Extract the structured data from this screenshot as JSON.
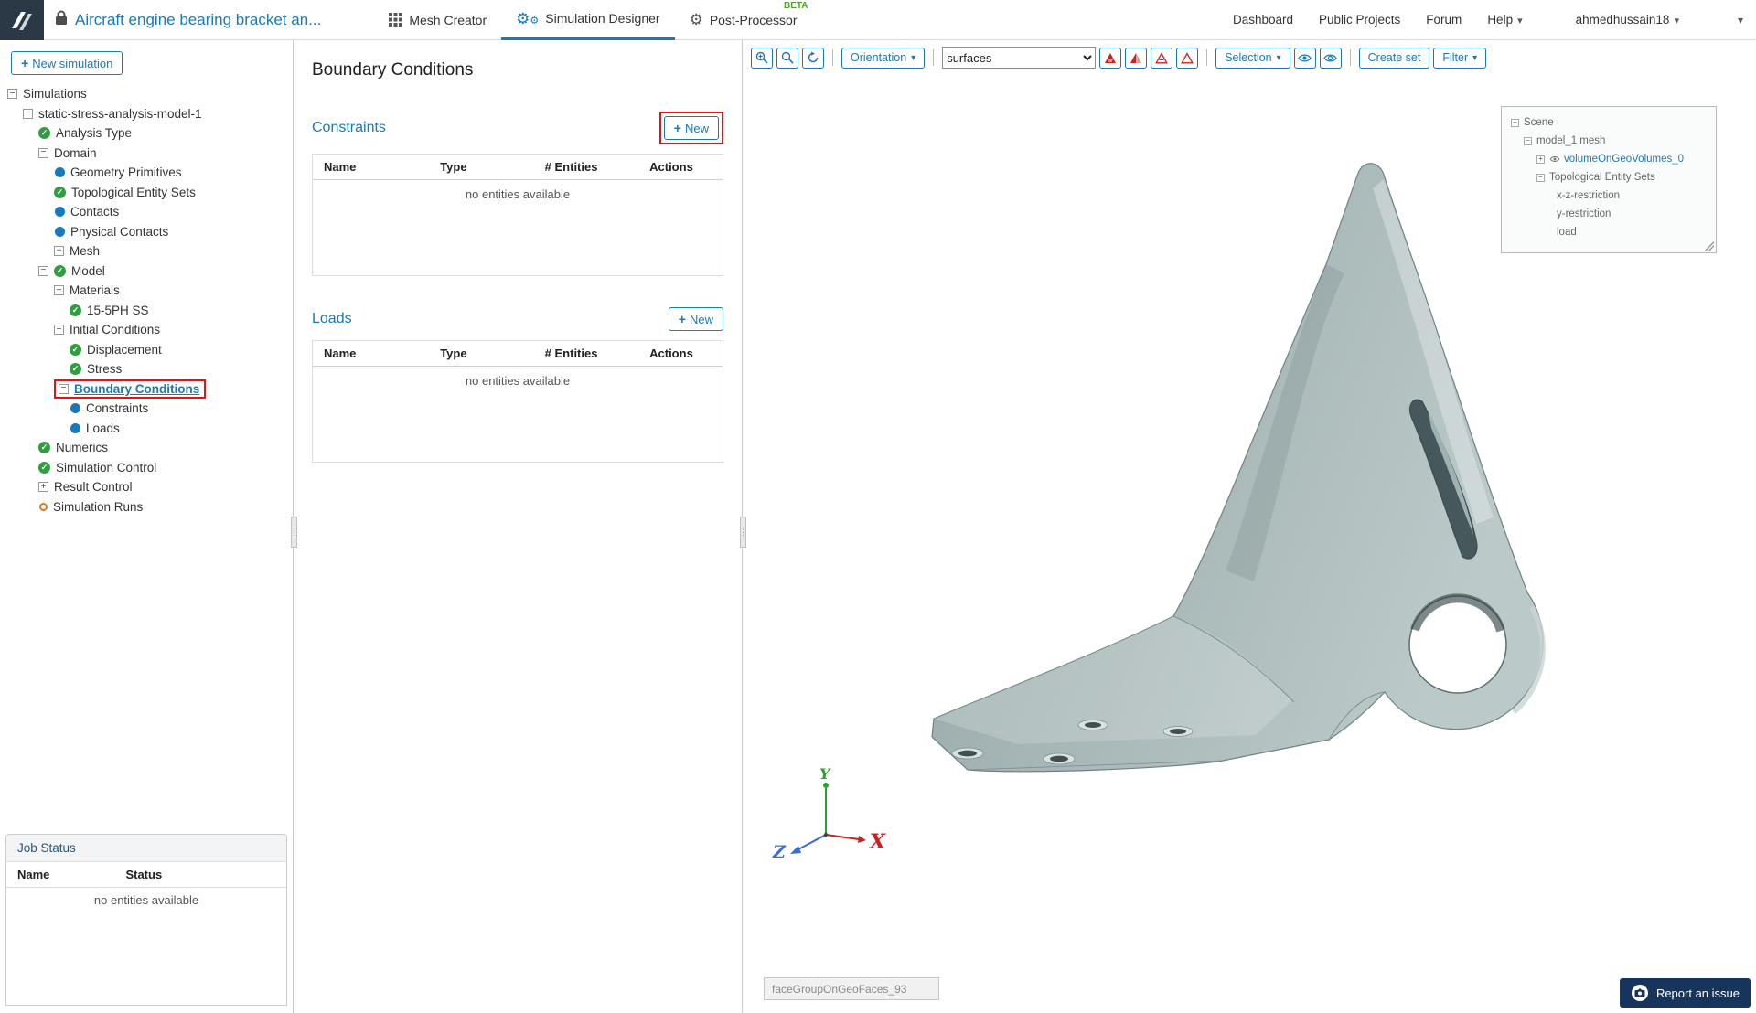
{
  "navbar": {
    "project_title": "Aircraft engine bearing bracket an...",
    "tabs": [
      {
        "label": "Mesh Creator"
      },
      {
        "label": "Simulation Designer"
      },
      {
        "label": "Post-Processor",
        "beta": "BETA"
      }
    ],
    "links": {
      "dashboard": "Dashboard",
      "public_projects": "Public Projects",
      "forum": "Forum",
      "help": "Help"
    },
    "user": "ahmedhussain18"
  },
  "sidebar": {
    "new_simulation_label": "New simulation",
    "tree": [
      {
        "label": "Simulations"
      },
      {
        "label": "static-stress-analysis-model-1"
      },
      {
        "label": "Analysis Type"
      },
      {
        "label": "Domain"
      },
      {
        "label": "Geometry Primitives"
      },
      {
        "label": "Topological Entity Sets"
      },
      {
        "label": "Contacts"
      },
      {
        "label": "Physical Contacts"
      },
      {
        "label": "Mesh"
      },
      {
        "label": "Model"
      },
      {
        "label": "Materials"
      },
      {
        "label": "15-5PH SS"
      },
      {
        "label": "Initial Conditions"
      },
      {
        "label": "Displacement"
      },
      {
        "label": "Stress"
      },
      {
        "label": "Boundary Conditions"
      },
      {
        "label": "Constraints"
      },
      {
        "label": "Loads"
      },
      {
        "label": "Numerics"
      },
      {
        "label": "Simulation Control"
      },
      {
        "label": "Result Control"
      },
      {
        "label": "Simulation Runs"
      }
    ],
    "job_status": {
      "title": "Job Status",
      "columns": {
        "name": "Name",
        "status": "Status"
      },
      "empty": "no entities available"
    }
  },
  "panel": {
    "title": "Boundary Conditions",
    "sections": [
      {
        "title": "Constraints",
        "new_label": "New",
        "columns": {
          "name": "Name",
          "type": "Type",
          "entities": "# Entities",
          "actions": "Actions"
        },
        "empty": "no entities available"
      },
      {
        "title": "Loads",
        "new_label": "New",
        "columns": {
          "name": "Name",
          "type": "Type",
          "entities": "# Entities",
          "actions": "Actions"
        },
        "empty": "no entities available"
      }
    ]
  },
  "viewer": {
    "toolbar": {
      "orientation_label": "Orientation",
      "surface_filter_value": "surfaces",
      "selection_label": "Selection",
      "create_set_label": "Create set",
      "filter_label": "Filter"
    },
    "scene_tree": [
      {
        "label": "Scene"
      },
      {
        "label": "model_1 mesh"
      },
      {
        "label": "volumeOnGeoVolumes_0"
      },
      {
        "label": "Topological Entity Sets"
      },
      {
        "label": "x-z-restriction"
      },
      {
        "label": "y-restriction"
      },
      {
        "label": "load"
      }
    ],
    "axes": {
      "x": "X",
      "y": "Y",
      "z": "Z"
    },
    "tooltip": "faceGroupOnGeoFaces_93",
    "report_label": "Report an issue"
  },
  "icons": {
    "logo": "simscale-logo-icon",
    "lock": "lock-icon",
    "grid": "grid-icon",
    "gears": "gears-icon",
    "gear": "gear-icon",
    "zoom_plus": "zoom-in-icon",
    "zoom": "zoom-box-icon",
    "refresh": "refresh-icon",
    "triangles": "mesh-quality-triangle-icons",
    "eye": "eye-icon",
    "camera": "camera-icon"
  },
  "colors": {
    "accent_blue": "#1a7ab5",
    "check_green": "#2f9e41",
    "dot_blue": "#1779be",
    "run_orange": "#e0761f",
    "highlight_red": "#e01414",
    "report_navy": "#16345c",
    "metal_gray": "#a7b6b6",
    "beta_green": "#4ca32a"
  }
}
